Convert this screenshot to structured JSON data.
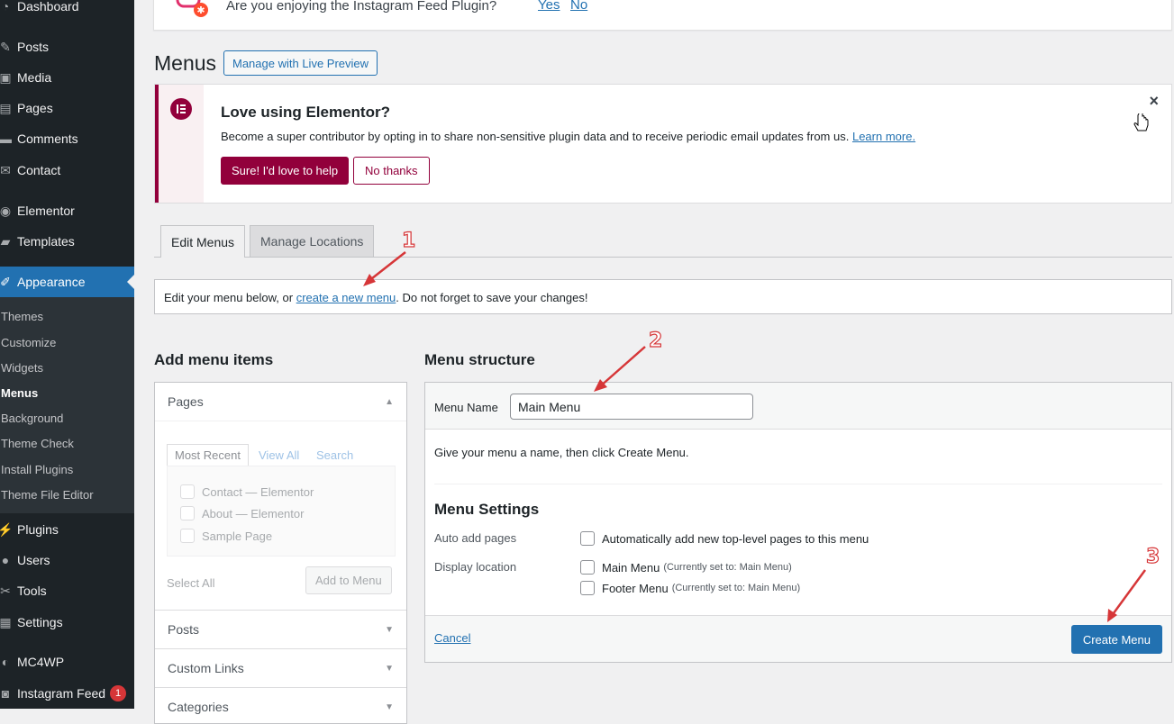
{
  "sidebar": {
    "items": [
      {
        "label": "Dashboard",
        "icon": "dashboard-icon"
      },
      {
        "label": "Posts",
        "icon": "pin-icon"
      },
      {
        "label": "Media",
        "icon": "media-icon"
      },
      {
        "label": "Pages",
        "icon": "pages-icon"
      },
      {
        "label": "Comments",
        "icon": "comment-icon"
      },
      {
        "label": "Contact",
        "icon": "mail-icon"
      },
      {
        "label": "Elementor",
        "icon": "elementor-icon"
      },
      {
        "label": "Templates",
        "icon": "folder-icon"
      },
      {
        "label": "Appearance",
        "icon": "brush-icon"
      },
      {
        "label": "Plugins",
        "icon": "plugin-icon"
      },
      {
        "label": "Users",
        "icon": "users-icon"
      },
      {
        "label": "Tools",
        "icon": "wrench-icon"
      },
      {
        "label": "Settings",
        "icon": "settings-icon"
      },
      {
        "label": "MC4WP",
        "icon": "mc4wp-icon"
      },
      {
        "label": "Instagram Feed",
        "icon": "camera-icon",
        "badge": "1"
      }
    ],
    "submenu": [
      "Themes",
      "Customize",
      "Widgets",
      "Menus",
      "Background",
      "Theme Check",
      "Install Plugins",
      "Theme File Editor"
    ]
  },
  "instagram_notice": {
    "text": "Are you enjoying the Instagram Feed Plugin?",
    "yes": "Yes",
    "no": "No"
  },
  "page": {
    "title": "Menus",
    "live_preview_button": "Manage with Live Preview"
  },
  "elementor_notice": {
    "title": "Love using Elementor?",
    "text": "Become a super contributor by opting in to share non-sensitive plugin data and to receive periodic email updates from us.",
    "learn_more": "Learn more.",
    "accept": "Sure! I'd love to help",
    "decline": "No thanks",
    "close": "×"
  },
  "tabs": [
    "Edit Menus",
    "Manage Locations"
  ],
  "edit_notice": {
    "before": "Edit your menu below, or ",
    "link": "create a new menu",
    "after": ". Do not forget to save your changes!"
  },
  "add_items": {
    "title": "Add menu items",
    "pages_section": "Pages",
    "page_tabs": [
      "Most Recent",
      "View All",
      "Search"
    ],
    "pages": [
      "Contact — Elementor",
      "About — Elementor",
      "Sample Page"
    ],
    "select_all": "Select All",
    "add_button": "Add to Menu",
    "sections": [
      "Posts",
      "Custom Links",
      "Categories"
    ]
  },
  "menu_structure": {
    "title": "Menu structure",
    "name_label": "Menu Name",
    "name_value": "Main Menu",
    "hint": "Give your menu a name, then click Create Menu.",
    "settings_title": "Menu Settings",
    "auto_add_label": "Auto add pages",
    "auto_add_option": "Automatically add new top-level pages to this menu",
    "display_label": "Display location",
    "locations": [
      {
        "name": "Main Menu",
        "note": "(Currently set to: Main Menu)"
      },
      {
        "name": "Footer Menu",
        "note": "(Currently set to: Main Menu)"
      }
    ],
    "cancel": "Cancel",
    "create": "Create Menu"
  },
  "annotations": [
    "1",
    "2",
    "3"
  ],
  "colors": {
    "accent": "#2271b1",
    "elementor": "#92003b",
    "annotation": "#d63638",
    "sidebar": "#1d2327"
  }
}
